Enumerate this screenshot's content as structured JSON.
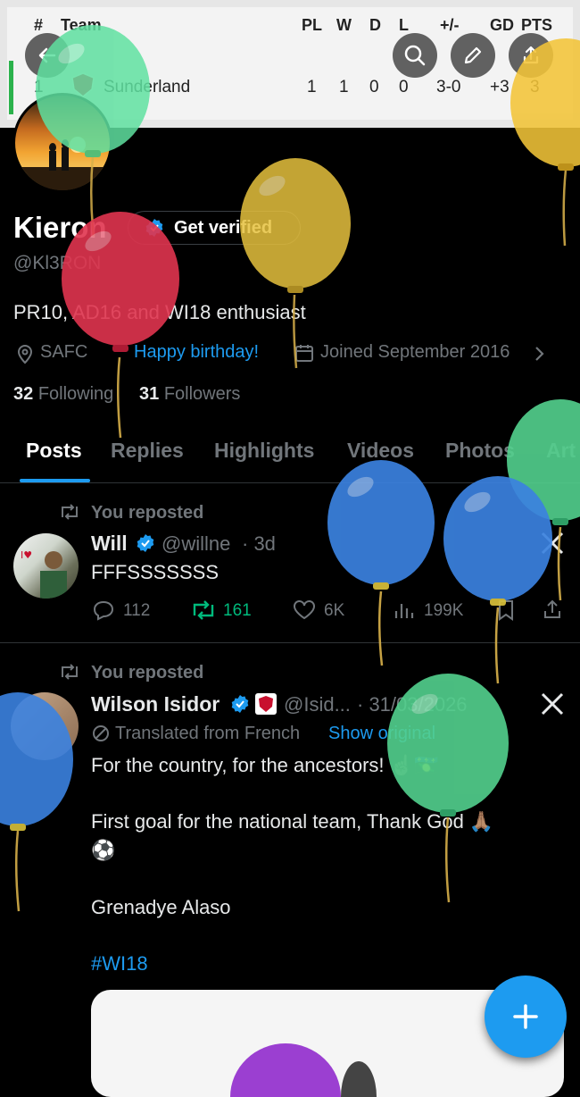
{
  "league_table": {
    "headers": {
      "pos": "#",
      "team": "Team",
      "pl": "PL",
      "w": "W",
      "d": "D",
      "l": "L",
      "pm": "+/-",
      "gd": "GD",
      "pts": "PTS"
    },
    "row": {
      "pos": "1",
      "team": "Sunderland",
      "pl": "1",
      "w": "1",
      "d": "0",
      "l": "0",
      "pm": "3-0",
      "gd": "+3",
      "pts": "3"
    }
  },
  "header_icons": [
    "back-arrow-icon",
    "search-icon",
    "edit-pencil-icon",
    "share-icon"
  ],
  "profile": {
    "name": "Kieron",
    "get_verified": "Get verified",
    "handle": "@Kl3RON",
    "bio": "PR10, AD16 and WI18 enthusiast",
    "location": "SAFC",
    "birthday": "Happy birthday!",
    "joined": "Joined September 2016",
    "following_count": "32",
    "following_label": "Following",
    "followers_count": "31",
    "followers_label": "Followers"
  },
  "tabs": [
    {
      "label": "Posts",
      "active": true
    },
    {
      "label": "Replies",
      "active": false
    },
    {
      "label": "Highlights",
      "active": false
    },
    {
      "label": "Videos",
      "active": false
    },
    {
      "label": "Photos",
      "active": false
    },
    {
      "label": "Art",
      "active": false
    }
  ],
  "posts": [
    {
      "repost_label": "You reposted",
      "author": "Will",
      "handle": "@willne",
      "time": "· 3d",
      "text": "FFFSSSSSSS",
      "replies": "112",
      "reposts": "161",
      "likes": "6K",
      "views": "199K"
    },
    {
      "repost_label": "You reposted",
      "author": "Wilson Isidor",
      "handle": "@Isid...",
      "time": "· 31/03/2026",
      "translated": "Translated from French",
      "show_original": "Show original",
      "line1": "For the country, for the ancestors! ☝🏿🇬🇵",
      "line2": "First goal for the national team, Thank God 🙏🏽",
      "line3": "⚽",
      "line4": "Grenadye Alaso",
      "hashtag": "#WI18"
    }
  ],
  "colors": {
    "accent": "#1d9bf0",
    "repost_green": "#00ba7c",
    "background": "#000000",
    "muted": "#71767b"
  }
}
